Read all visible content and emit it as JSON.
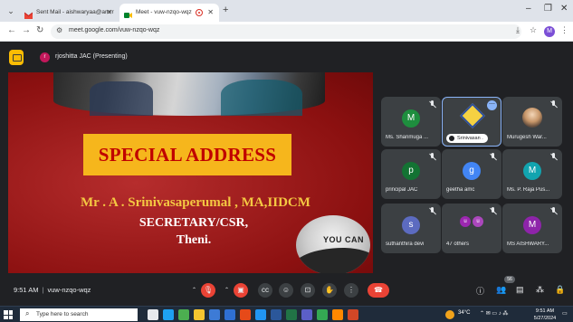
{
  "browser": {
    "tabs": [
      {
        "title": "Sent Mail - aishwaryaa@amrr",
        "active": false
      },
      {
        "title": "Meet - vuw-nzqo-wqz",
        "active": true
      }
    ],
    "new_tab": "+",
    "url": "meet.google.com/vuw-nzqo-wqz",
    "profile_initial": "M"
  },
  "meet": {
    "presenter_initial": "r",
    "presenter_label": "rjoshitta JAC (Presenting)",
    "slide": {
      "banner": "SPECIAL ADDRESS",
      "speaker": "Mr . A . Srinivasaperumal , MA,IIDCM",
      "role": "SECRETARY/CSR,",
      "city": "Theni.",
      "logo_text": "YOU CAN"
    },
    "participants": [
      {
        "name": "Ms. Shanmuga ...",
        "initial": "M",
        "color": "#1e8e3e",
        "kind": "initial"
      },
      {
        "name": "Srinivasan .",
        "initial": "",
        "color": "#2c4f9e",
        "kind": "logo"
      },
      {
        "name": "Murugesh War...",
        "initial": "",
        "color": "#777777",
        "kind": "photo"
      },
      {
        "name": "principal JAC",
        "initial": "p",
        "color": "#137333",
        "kind": "initial"
      },
      {
        "name": "geetha amc",
        "initial": "g",
        "color": "#4285f4",
        "kind": "initial"
      },
      {
        "name": "Ms. P. Raja Pus...",
        "initial": "M",
        "color": "#12a4af",
        "kind": "initial"
      },
      {
        "name": "suthanthira devi",
        "initial": "s",
        "color": "#5c6bc0",
        "kind": "initial"
      },
      {
        "name": "47 others",
        "initial": "",
        "color": "#5f6368",
        "kind": "others",
        "stack": [
          "u",
          "u"
        ]
      },
      {
        "name": "MS AISHWARY...",
        "initial": "M",
        "color": "#8e24aa",
        "kind": "initial"
      }
    ],
    "meeting_time": "9:51 AM",
    "meeting_code": "vuw-nzqo-wqz",
    "participant_count": "56",
    "separator": "|"
  },
  "taskbar": {
    "search_placeholder": "Type here to search",
    "weather": "34°C",
    "clock_time": "9:51 AM",
    "clock_date": "5/27/2024"
  },
  "colors": {
    "meet_bg": "#202124",
    "slide_red": "#8b1010",
    "banner_yellow": "#f6b61c",
    "banner_text": "#c00000",
    "speaker_text": "#f4c842",
    "hangup_red": "#ea4335"
  }
}
